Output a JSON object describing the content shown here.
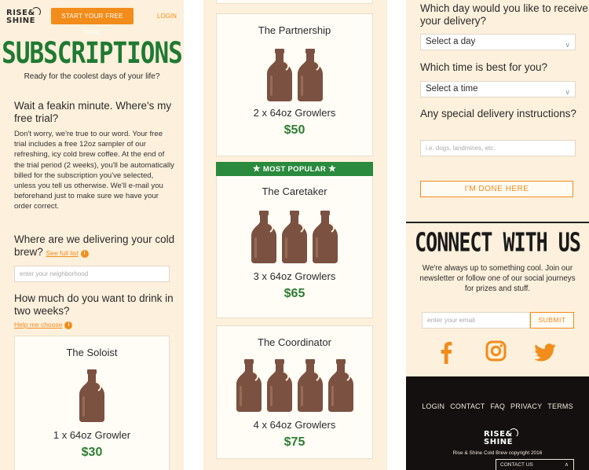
{
  "brand": {
    "logo_line1": "RISE&",
    "logo_line2": "SHINE"
  },
  "header": {
    "trial_button": "START YOUR FREE TRIAL",
    "login": "LOGIN"
  },
  "subscriptions": {
    "title": "SUBSCRIPTIONS",
    "tagline": "Ready for the coolest days of your life?",
    "trial_heading": "Wait a feakin minute. Where's my free trial?",
    "trial_body": "Don't worry, we're true to our word. Your free trial includes a free 12oz sampler of our refreshing, icy cold brew coffee. At the end of the trial period (2 weeks), you'll be automatically billed for the subscription you've selected, unless you tell us otherwise. We'll e-mail you beforehand just to make sure we have your order correct.",
    "delivery_heading": "Where are we delivering your cold brew?",
    "delivery_link": "See full list",
    "neighborhood_placeholder": "enter your neighborhood",
    "amount_heading": "How much do you want to drink in two weeks?",
    "help_link": "Help me choose"
  },
  "plans": [
    {
      "name": "The Soloist",
      "description": "1 x 64oz Growler",
      "price": "$30",
      "growlers": 1
    },
    {
      "name": "The Partnership",
      "description": "2 x 64oz Growlers",
      "price": "$50",
      "growlers": 2
    },
    {
      "name": "The Caretaker",
      "description": "3 x 64oz Growlers",
      "price": "$65",
      "growlers": 3,
      "badge": "MOST POPULAR"
    },
    {
      "name": "The Coordinator",
      "description": "4 x 64oz Growlers",
      "price": "$75",
      "growlers": 4
    }
  ],
  "delivery": {
    "day_question": "Which day would you like to receive your delivery?",
    "day_select": "Select a day",
    "time_question": "Which time is best for you?",
    "time_select": "Select a time",
    "instructions_question": "Any special delivery instructions?",
    "instructions_placeholder": "i.e. dogs, landmines, etc.",
    "done_button": "I'M DONE HERE"
  },
  "connect": {
    "title": "CONNECT WITH US",
    "body": "We're always up to something cool. Join our newsletter or follow one of our social journeys for prizes and stuff.",
    "email_placeholder": "enter your email",
    "submit": "SUBMIT",
    "social_icons": [
      "facebook-icon",
      "instagram-icon",
      "twitter-icon"
    ]
  },
  "footer": {
    "links": [
      "LOGIN",
      "CONTACT",
      "FAQ",
      "PRIVACY",
      "TERMS"
    ],
    "copyright": "Rise & Shine Cold Brew copyright 2016",
    "contact_tab": "CONTACT US"
  },
  "colors": {
    "accent": "#f28c1a",
    "green": "#1f7a32",
    "panel": "#fdf0dc",
    "footer": "#141010",
    "growler": "#7b5142"
  }
}
